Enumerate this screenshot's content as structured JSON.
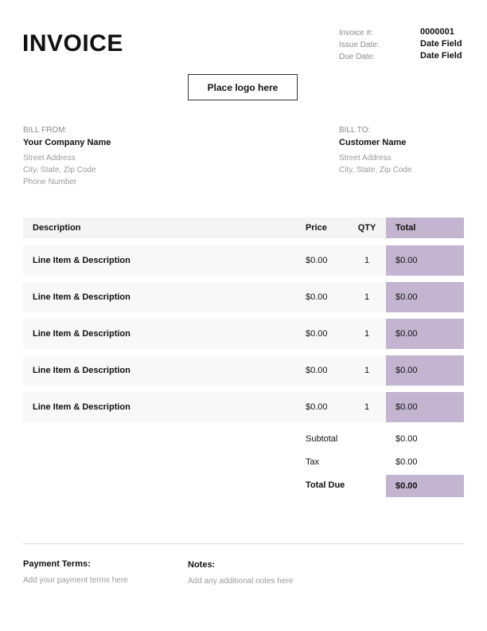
{
  "invoice": {
    "title": "INVOICE",
    "meta": [
      {
        "label": "Invoice #:",
        "value": "0000001"
      },
      {
        "label": "Issue Date:",
        "value": "Date Field"
      },
      {
        "label": "Due Date:",
        "value": "Date Field"
      }
    ],
    "logo_placeholder": "Place logo here"
  },
  "bill_from": {
    "heading": "BILL FROM:",
    "name": "Your Company Name",
    "lines": [
      "Street Address",
      "City, State, Zip Code",
      "Phone Number"
    ]
  },
  "bill_to": {
    "heading": "BILL TO:",
    "name": "Customer Name",
    "lines": [
      "Street Address",
      "City, State, Zip Code"
    ]
  },
  "table": {
    "headers": {
      "description": "Description",
      "price": "Price",
      "qty": "QTY",
      "total": "Total"
    },
    "rows": [
      {
        "description": "Line Item & Description",
        "price": "$0.00",
        "qty": "1",
        "total": "$0.00"
      },
      {
        "description": "Line Item & Description",
        "price": "$0.00",
        "qty": "1",
        "total": "$0.00"
      },
      {
        "description": "Line Item & Description",
        "price": "$0.00",
        "qty": "1",
        "total": "$0.00"
      },
      {
        "description": "Line Item & Description",
        "price": "$0.00",
        "qty": "1",
        "total": "$0.00"
      },
      {
        "description": "Line Item & Description",
        "price": "$0.00",
        "qty": "1",
        "total": "$0.00"
      }
    ]
  },
  "summary": {
    "subtotal_label": "Subtotal",
    "subtotal_value": "$0.00",
    "tax_label": "Tax",
    "tax_value": "$0.00",
    "total_due_label": "Total Due",
    "total_due_value": "$0.00"
  },
  "footer": {
    "payment_terms_heading": "Payment Terms:",
    "payment_terms_text": "Add your payment terms here",
    "notes_heading": "Notes:",
    "notes_text": "Add any additional notes here"
  },
  "colors": {
    "accent": "#c3b5d0",
    "header_bg": "#f4f4f4",
    "row_bg": "#f8f8f8"
  }
}
